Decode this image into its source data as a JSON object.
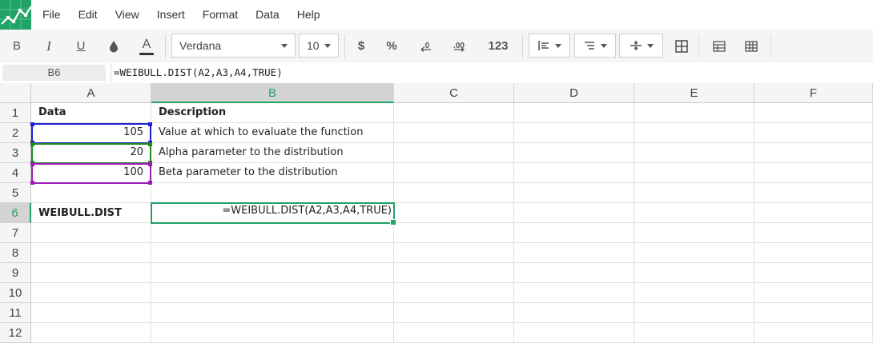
{
  "menu": [
    "File",
    "Edit",
    "View",
    "Insert",
    "Format",
    "Data",
    "Help"
  ],
  "toolbar": {
    "bold": "B",
    "italic": "I",
    "underline": "U",
    "text_color": "A",
    "font_name": "Verdana",
    "font_size": "10",
    "currency": "$",
    "percent": "%",
    "dec_decrease": ".0",
    "dec_increase": ".00",
    "number_format": "123"
  },
  "formula_bar": {
    "cell_ref": "B6",
    "formula": "=WEIBULL.DIST(A2,A3,A4,TRUE)"
  },
  "columns": [
    "A",
    "B",
    "C",
    "D",
    "E",
    "F"
  ],
  "rows": [
    "1",
    "2",
    "3",
    "4",
    "5",
    "6",
    "7",
    "8",
    "9",
    "10",
    "11",
    "12"
  ],
  "cells": {
    "A1": "Data",
    "B1": "Description",
    "A2": "105",
    "B2": "Value at which to evaluate the function",
    "A3": "20",
    "B3": "Alpha parameter to the distribution",
    "A4": "100",
    "B4": "Beta parameter to the distribution",
    "A6": "WEIBULL.DIST",
    "B6": "=WEIBULL.DIST(A2,A3,A4,TRUE)"
  },
  "colors": {
    "accent": "#21a366",
    "ref_a2": "#1f1fd1",
    "ref_a3": "#1e8a1e",
    "ref_a4": "#9b1fb5"
  }
}
